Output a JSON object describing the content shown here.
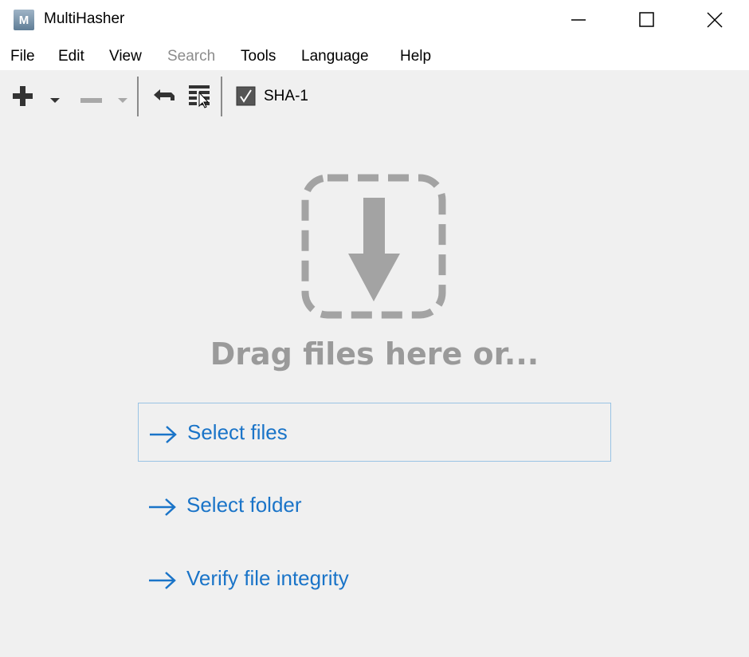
{
  "window": {
    "title": "MultiHasher",
    "app_icon_letter": "M",
    "controls": [
      "minimize",
      "maximize",
      "close"
    ]
  },
  "menu": {
    "items": [
      {
        "label": "File",
        "enabled": true
      },
      {
        "label": "Edit",
        "enabled": true
      },
      {
        "label": "View",
        "enabled": true
      },
      {
        "label": "Search",
        "enabled": false
      },
      {
        "label": "Tools",
        "enabled": true
      },
      {
        "label": "Language",
        "enabled": true
      },
      {
        "label": "Help",
        "enabled": true
      }
    ]
  },
  "toolbar": {
    "buttons": [
      {
        "name": "add",
        "icon": "plus-icon",
        "enabled": true
      },
      {
        "name": "add-dropdown",
        "icon": "caret-down-icon",
        "enabled": true
      },
      {
        "name": "remove",
        "icon": "minus-icon",
        "enabled": false
      },
      {
        "name": "remove-dropdown",
        "icon": "caret-down-icon",
        "enabled": false
      },
      {
        "name": "back",
        "icon": "back-arrow-icon",
        "enabled": true
      },
      {
        "name": "columns",
        "icon": "columns-icon",
        "enabled": true
      }
    ],
    "algorithm": {
      "label": "SHA-1",
      "checked": true
    }
  },
  "dropzone": {
    "icon": "download-arrow-icon",
    "text": "Drag files here or..."
  },
  "actions": [
    {
      "label": "Select files",
      "icon": "arrow-right-icon",
      "focused": true
    },
    {
      "label": "Select folder",
      "icon": "arrow-right-icon",
      "focused": false
    },
    {
      "label": "Verify file integrity",
      "icon": "arrow-right-icon",
      "focused": false
    }
  ],
  "colors": {
    "accent": "#1a74c8",
    "focus_border": "#99c3e4",
    "muted": "#9a9a9a",
    "background": "#f0f0f0"
  }
}
